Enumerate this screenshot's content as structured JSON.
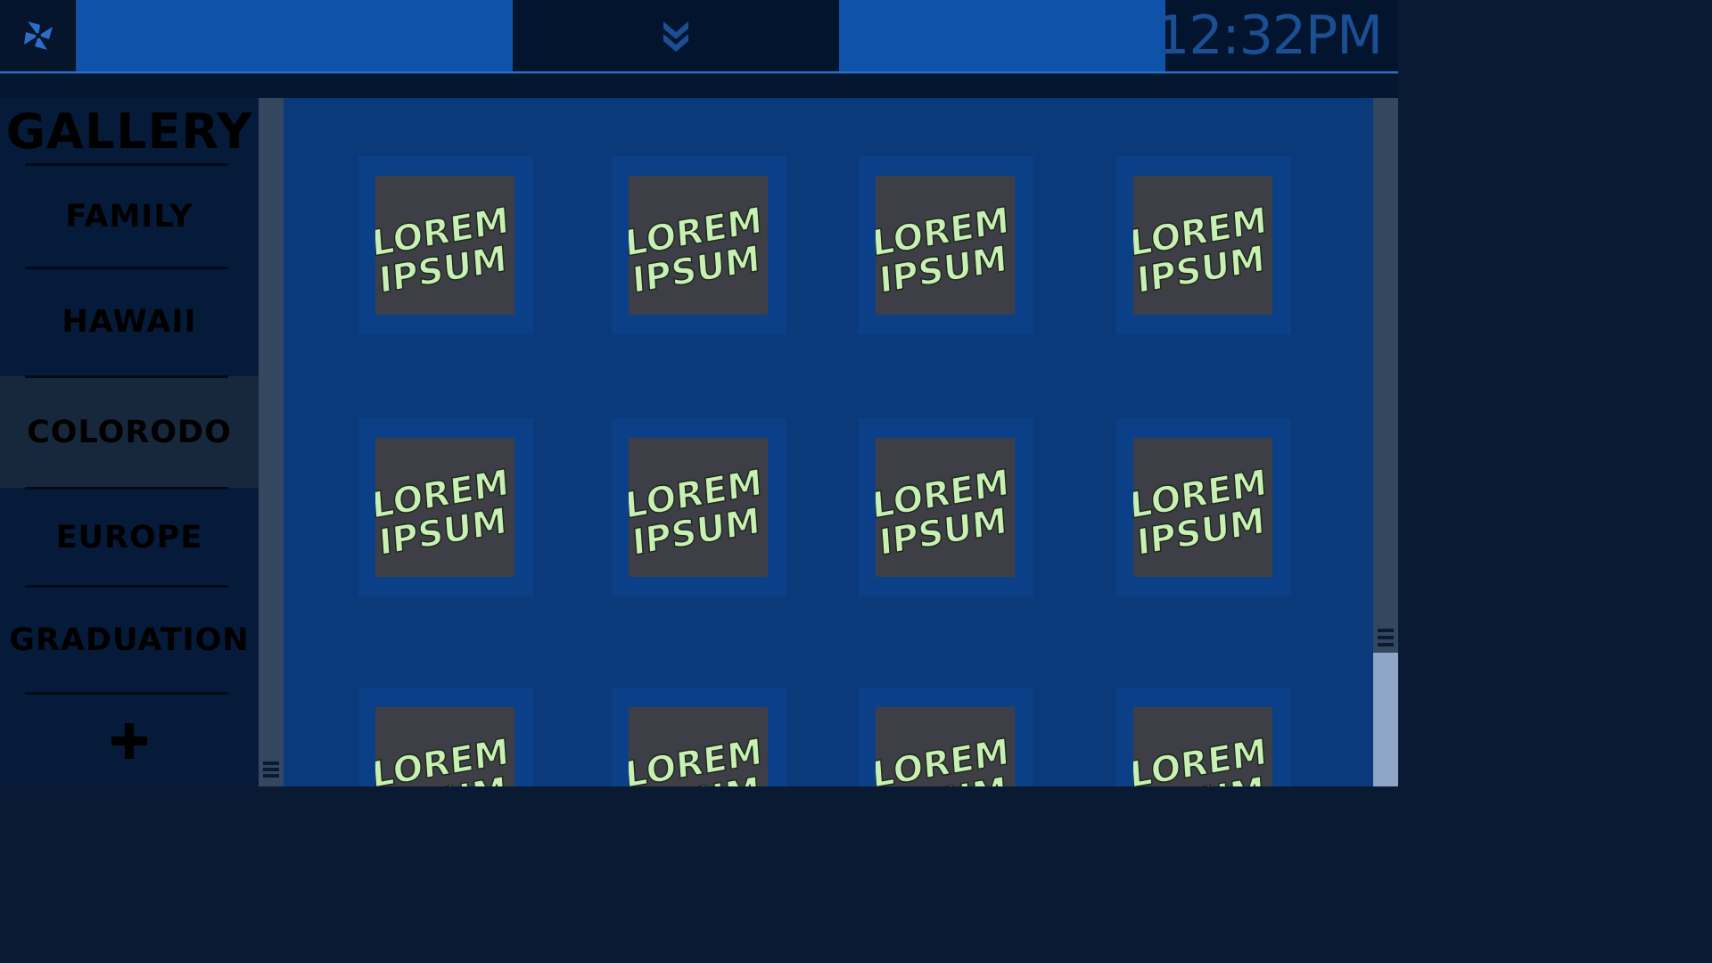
{
  "topbar": {
    "logo_icon": "pinwheel-icon",
    "center_icon": "double-chevron-down-icon",
    "clock": "12:32PM"
  },
  "sidebar": {
    "title": "GALLERY",
    "items": [
      {
        "label": "FAMILY",
        "active": false
      },
      {
        "label": "HAWAII",
        "active": false
      },
      {
        "label": "COLORODO",
        "active": true
      },
      {
        "label": "EUROPE",
        "active": false
      },
      {
        "label": "GRADUATION",
        "active": false
      }
    ],
    "add_icon": "plus-icon"
  },
  "gallery": {
    "thumbnail_text": [
      "LOREM",
      "IPSUM"
    ],
    "tiles": 12
  },
  "colors": {
    "accent": "#0f52aa",
    "background": "#0a3a7a",
    "thumbnail_text": "#c8efb4"
  }
}
